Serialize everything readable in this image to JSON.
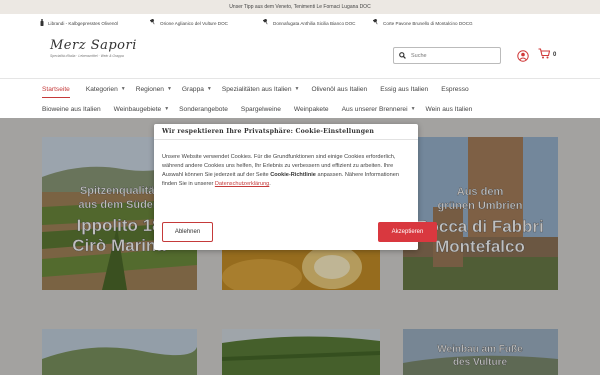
{
  "topbar": {
    "text": "Unser Tipp aus dem Veneto, Tenimenti Le Fornaci Lugana DOC"
  },
  "usp": [
    {
      "icon": "bottle-icon",
      "text": "Librandi - Kalbgepresstes Olivenöl"
    },
    {
      "icon": "wine-glass-icon",
      "text": "Orione Aglianico del Vulture DOC"
    },
    {
      "icon": "wine-glass-icon",
      "text": "Donnafugata Anthilia Sicilia Bianco DOC"
    },
    {
      "icon": "wine-glass-icon",
      "text": "Corte Pavone Brunello di Montalcino DOCG"
    }
  ],
  "logo": {
    "brand": "Merz Sapori",
    "tagline": "Specialità d'Italia · Lebensmittel · Wein & Grappa"
  },
  "search": {
    "placeholder": "Suche",
    "value": ""
  },
  "cart": {
    "count": "0"
  },
  "nav": {
    "row1": [
      {
        "label": "Startseite",
        "dropdown": false,
        "active": true
      },
      {
        "label": "Kategorien",
        "dropdown": true,
        "active": false
      },
      {
        "label": "Regionen",
        "dropdown": true,
        "active": false
      },
      {
        "label": "Grappa",
        "dropdown": true,
        "active": false
      },
      {
        "label": "Spezialitäten aus Italien",
        "dropdown": true,
        "active": false
      },
      {
        "label": "Olivenöl aus Italien",
        "dropdown": false,
        "active": false
      },
      {
        "label": "Essig aus Italien",
        "dropdown": false,
        "active": false
      },
      {
        "label": "Espresso",
        "dropdown": false,
        "active": false
      }
    ],
    "row2": [
      {
        "label": "Bioweine aus Italien",
        "dropdown": false
      },
      {
        "label": "Weinbaugebiete",
        "dropdown": true
      },
      {
        "label": "Sonderangebote",
        "dropdown": false
      },
      {
        "label": "Spargelweine",
        "dropdown": false
      },
      {
        "label": "Weinpakete",
        "dropdown": false
      },
      {
        "label": "Aus unserer Brennerei",
        "dropdown": true
      },
      {
        "label": "Wein aus Italien",
        "dropdown": false
      }
    ]
  },
  "tiles": {
    "t1": {
      "line1": "Spitzenqualität",
      "line2": "aus dem Süden",
      "line3": "Ippolito 18",
      "line4": "Cirò Marina"
    },
    "t3": {
      "line1": "Aus dem",
      "line2": "grünen Umbrien",
      "line3": "Rocca di Fabbri",
      "line4": "Montefalco"
    },
    "t6": {
      "line1": "Weinbau am Fuße",
      "line2": "des Vulture"
    }
  },
  "cookie": {
    "title": "Wir respektieren Ihre Privatsphäre: Cookie-Einstellungen",
    "body_pre": "Unsere Website verwendet Cookies. Für die Grundfunktionen sind einige Cookies erforderlich, während andere Cookies uns helfen, Ihr Erlebnis zu verbessern und effizient zu arbeiten. Ihre Auswahl können Sie jederzeit auf der Seite ",
    "body_bold": "Cookie-Richtlinie",
    "body_mid": " anpassen. Nähere Informationen finden Sie in unserer ",
    "body_link": "Datenschutzerklärung",
    "body_post": ".",
    "reject_label": "Ablehnen",
    "accept_label": "Akzeptieren"
  },
  "colors": {
    "accent": "#c53a3a",
    "accept_button": "#d9383f",
    "background": "#f1efec"
  }
}
